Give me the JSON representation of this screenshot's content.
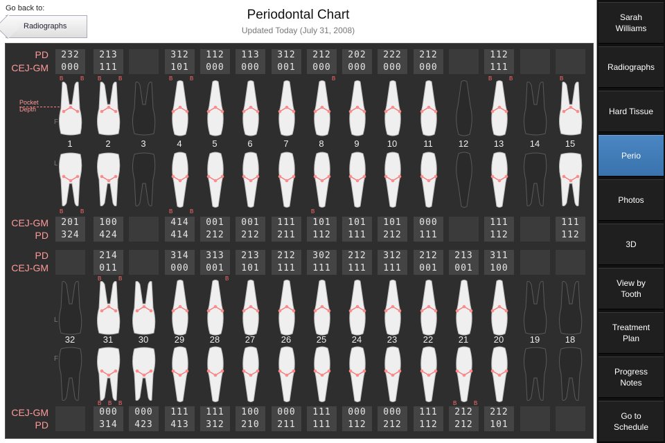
{
  "header": {
    "back_caption": "Go back to:",
    "back_label": "Radiographs",
    "title": "Periodontal Chart",
    "subtitle": "Updated Today (July 31, 2008)"
  },
  "annotation": {
    "pocket": "Pocket",
    "depth": "Depth"
  },
  "row_labels": {
    "pd": "PD",
    "cejgm": "CEJ-GM",
    "side_f": "F",
    "side_l": "L"
  },
  "colors": {
    "accent": "#3a73ae",
    "label": "#ff9a9a",
    "bleed": "#ff6b6b"
  },
  "bleed_mark": "B",
  "sidebar": [
    {
      "label": "Sarah\nWilliams",
      "active": false
    },
    {
      "label": "Radiographs",
      "active": false
    },
    {
      "label": "Hard Tissue",
      "active": false
    },
    {
      "label": "Perio",
      "active": true
    },
    {
      "label": "Photos",
      "active": false
    },
    {
      "label": "3D",
      "active": false
    },
    {
      "label": "View by\nTooth",
      "active": false
    },
    {
      "label": "Treatment\nPlan",
      "active": false
    },
    {
      "label": "Progress\nNotes",
      "active": false
    },
    {
      "label": "Go to\nSchedule",
      "active": false
    }
  ],
  "upper": {
    "teeth": [
      "1",
      "2",
      "3",
      "4",
      "5",
      "6",
      "7",
      "8",
      "9",
      "10",
      "11",
      "12",
      "13",
      "14",
      "15"
    ],
    "missing": [
      false,
      false,
      true,
      false,
      false,
      false,
      false,
      false,
      false,
      false,
      false,
      true,
      false,
      true,
      false
    ],
    "facial_pd": [
      "232",
      "213",
      "",
      "312",
      "112",
      "113",
      "312",
      "212",
      "202",
      "222",
      "212",
      "",
      "112",
      "",
      ""
    ],
    "facial_cejgm": [
      "000",
      "111",
      "",
      "101",
      "000",
      "000",
      "001",
      "000",
      "000",
      "000",
      "000",
      "",
      "111",
      "",
      ""
    ],
    "facial_bleed": [
      "0,2",
      "0,2",
      "",
      "0,2",
      "",
      "",
      "",
      "2",
      "",
      "",
      "",
      "",
      "0,2",
      "",
      "0"
    ],
    "lingual_bleed": [
      "0,2",
      "",
      "",
      "0,2",
      "",
      "",
      "",
      "0",
      "",
      "",
      "",
      "",
      "",
      "",
      ""
    ],
    "lingual_cejgm": [
      "201",
      "100",
      "",
      "414",
      "001",
      "001",
      "111",
      "101",
      "101",
      "101",
      "000",
      "",
      "111",
      "",
      "111"
    ],
    "lingual_pd": [
      "324",
      "424",
      "",
      "414",
      "212",
      "212",
      "211",
      "112",
      "111",
      "212",
      "111",
      "",
      "112",
      "",
      "112"
    ]
  },
  "lower": {
    "teeth": [
      "32",
      "31",
      "30",
      "29",
      "28",
      "27",
      "26",
      "25",
      "24",
      "23",
      "22",
      "21",
      "20",
      "19",
      "18"
    ],
    "missing": [
      true,
      false,
      false,
      false,
      false,
      false,
      false,
      false,
      false,
      false,
      false,
      false,
      false,
      true,
      true
    ],
    "lingual_pd": [
      "",
      "214",
      "",
      "314",
      "313",
      "213",
      "212",
      "302",
      "212",
      "312",
      "212",
      "213",
      "311",
      "",
      ""
    ],
    "lingual_cejgm": [
      "",
      "011",
      "",
      "000",
      "001",
      "101",
      "111",
      "111",
      "111",
      "111",
      "001",
      "001",
      "100",
      "",
      ""
    ],
    "lingual_bleed": [
      "",
      "0,2",
      "",
      "",
      "2",
      "",
      "",
      "",
      "",
      "",
      "",
      "",
      "",
      "",
      ""
    ],
    "facial_bleed": [
      "",
      "0,1,2",
      "",
      "",
      "",
      "",
      "",
      "",
      "",
      "",
      "",
      "0,2",
      "",
      "",
      ""
    ],
    "facial_cejgm": [
      "",
      "000",
      "000",
      "111",
      "111",
      "100",
      "000",
      "111",
      "000",
      "000",
      "111",
      "212",
      "212",
      "",
      ""
    ],
    "facial_pd": [
      "",
      "314",
      "423",
      "413",
      "312",
      "210",
      "211",
      "111",
      "112",
      "212",
      "112",
      "212",
      "101",
      "",
      ""
    ]
  }
}
